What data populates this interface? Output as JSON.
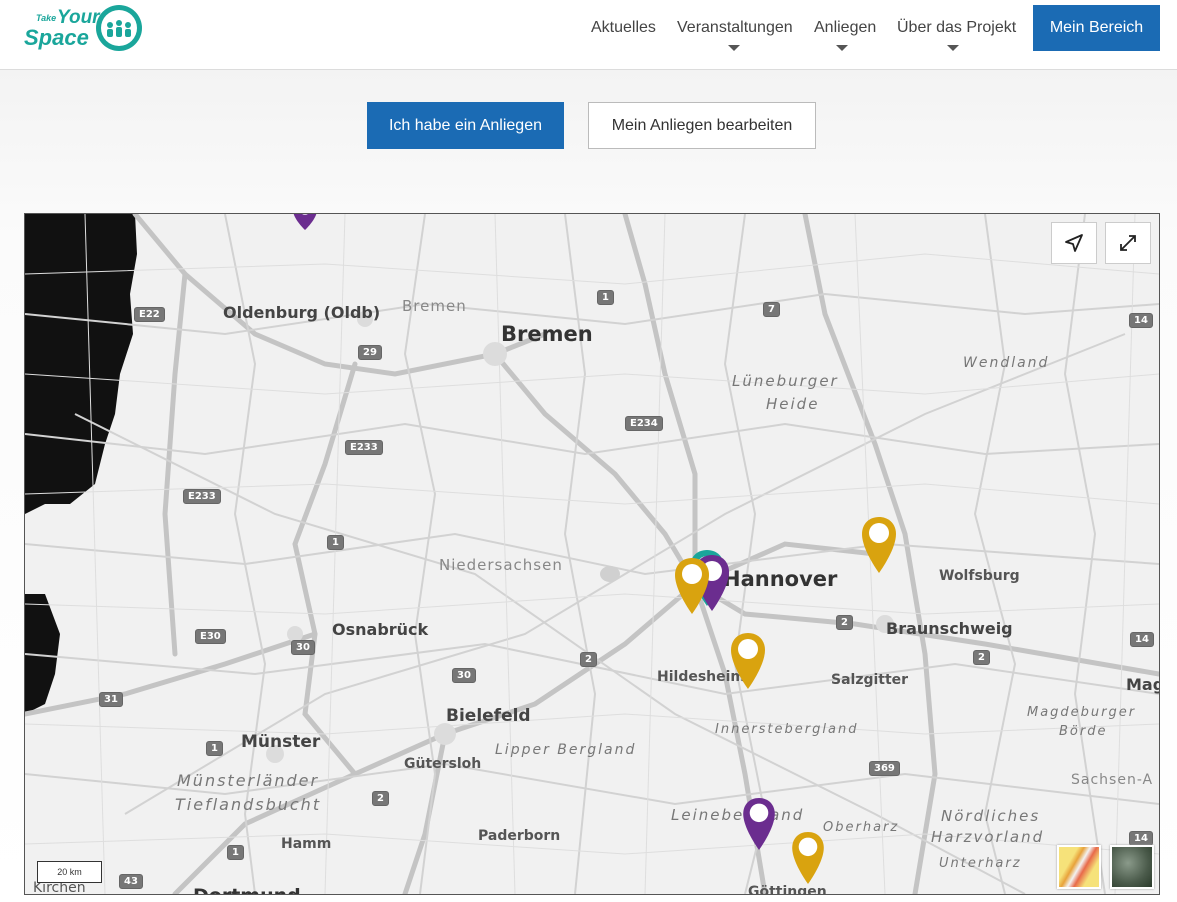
{
  "header": {
    "logo": {
      "line1": "Take",
      "line2": "Your",
      "line3": "Space"
    },
    "nav": [
      {
        "label": "Aktuelles",
        "has_dropdown": false
      },
      {
        "label": "Veranstaltungen",
        "has_dropdown": true
      },
      {
        "label": "Anliegen",
        "has_dropdown": true
      },
      {
        "label": "Über das Projekt",
        "has_dropdown": true
      }
    ],
    "account_button": "Mein Bereich"
  },
  "actions": {
    "primary": "Ich habe ein Anliegen",
    "secondary": "Mein Anliegen bearbeiten"
  },
  "map": {
    "cities": {
      "bremen": "Bremen",
      "bremen_small": "Bremen",
      "hannover": "Hannover",
      "oldenburg": "Oldenburg (Oldb)",
      "osnabrueck": "Osnabrück",
      "bielefeld": "Bielefeld",
      "muenster": "Münster",
      "guetersloh": "Gütersloh",
      "paderborn": "Paderborn",
      "hamm": "Hamm",
      "hildesheim": "Hildesheim",
      "salzgitter": "Salzgitter",
      "braunschweig": "Braunschweig",
      "wolfsburg": "Wolfsburg",
      "niedersachsen": "Niedersachsen",
      "goettingen": "Göttingen",
      "dortmund": "Dortmund",
      "kirchen": "Kirchen",
      "mag": "Mag"
    },
    "regions": {
      "lueneburger": "Lüneburger",
      "heide": "Heide",
      "wendland": "Wendland",
      "lipper": "Lipper Bergland",
      "muensterlaender": "Münsterländer",
      "tieflandsbucht": "Tieflandsbucht",
      "innerste": "Innerstebergland",
      "leinebergland": "Leinebergland",
      "oberharz": "Oberharz",
      "noerdliches": "Nördliches",
      "harzvorland": "Harzvorland",
      "unterharz": "Unterharz",
      "magdeburger": "Magdeburger",
      "boerde": "Börde",
      "sachsen": "Sachsen-A"
    },
    "road_shields": [
      "E22",
      "29",
      "1",
      "7",
      "E234",
      "14",
      "E233",
      "E233",
      "1",
      "E30",
      "30",
      "2",
      "30",
      "31",
      "1",
      "2",
      "1",
      "43",
      "2",
      "14",
      "2",
      "369",
      "14"
    ],
    "scale_label": "20 km",
    "controls": {
      "locate": "locate-icon",
      "fullscreen": "expand-icon"
    },
    "pin_colors": {
      "gold": "#d9a30f",
      "purple": "#6b2d8f",
      "teal": "#1aa69b"
    }
  }
}
